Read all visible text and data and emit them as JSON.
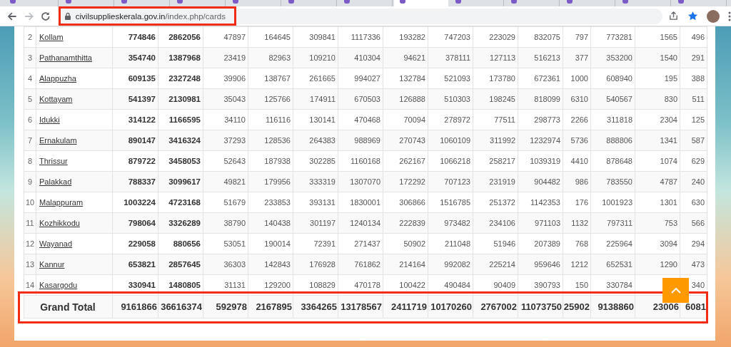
{
  "browser": {
    "tabs": [
      {
        "selected": false
      },
      {
        "selected": false
      },
      {
        "selected": false
      },
      {
        "selected": false
      },
      {
        "selected": false
      },
      {
        "selected": false
      },
      {
        "selected": false
      },
      {
        "selected": true
      },
      {
        "selected": false
      },
      {
        "selected": false
      },
      {
        "selected": false
      },
      {
        "selected": false
      },
      {
        "selected": false
      }
    ],
    "address_bar": {
      "host": "civilsupplieskerala.gov.in",
      "path": "/index.php/cards",
      "highlighted": true
    }
  },
  "table": {
    "rows": [
      {
        "no": "2",
        "district": "Kollam",
        "values": [
          "774846",
          "2862056",
          "47897",
          "164645",
          "309841",
          "1117336",
          "193282",
          "747203",
          "223029",
          "832075",
          "797",
          "773281",
          "1565",
          "496"
        ]
      },
      {
        "no": "3",
        "district": "Pathanamthitta",
        "values": [
          "354740",
          "1387968",
          "23419",
          "82963",
          "109210",
          "410304",
          "94621",
          "378111",
          "127113",
          "516213",
          "377",
          "353200",
          "1540",
          "291"
        ]
      },
      {
        "no": "4",
        "district": "Alappuzha",
        "values": [
          "609135",
          "2327248",
          "39906",
          "138767",
          "261665",
          "994027",
          "132784",
          "521093",
          "173780",
          "672361",
          "1000",
          "608940",
          "195",
          "388"
        ]
      },
      {
        "no": "5",
        "district": "Kottayam",
        "values": [
          "541397",
          "2130981",
          "35043",
          "125766",
          "174911",
          "670503",
          "126888",
          "510303",
          "198245",
          "818099",
          "6310",
          "540567",
          "830",
          "511"
        ]
      },
      {
        "no": "6",
        "district": "Idukki",
        "values": [
          "314122",
          "1166595",
          "34110",
          "116116",
          "130141",
          "470468",
          "70094",
          "278972",
          "77511",
          "298773",
          "2266",
          "311818",
          "2304",
          "125"
        ]
      },
      {
        "no": "7",
        "district": "Ernakulam",
        "values": [
          "890147",
          "3416324",
          "37293",
          "128536",
          "264383",
          "988969",
          "270743",
          "1060109",
          "311992",
          "1232974",
          "5736",
          "888806",
          "1341",
          "587"
        ]
      },
      {
        "no": "8",
        "district": "Thrissur",
        "values": [
          "879722",
          "3458053",
          "52643",
          "187938",
          "302285",
          "1160168",
          "262167",
          "1066218",
          "258217",
          "1039319",
          "4410",
          "878648",
          "1074",
          "629"
        ]
      },
      {
        "no": "9",
        "district": "Palakkad",
        "values": [
          "788337",
          "3099617",
          "49821",
          "179956",
          "333319",
          "1307070",
          "172292",
          "707123",
          "231919",
          "904482",
          "986",
          "783550",
          "4787",
          "240"
        ]
      },
      {
        "no": "10",
        "district": "Malappuram",
        "values": [
          "1003224",
          "4723168",
          "51679",
          "233853",
          "393131",
          "1830001",
          "306866",
          "1516785",
          "251372",
          "1142353",
          "176",
          "1001923",
          "1301",
          "630"
        ]
      },
      {
        "no": "11",
        "district": "Kozhikkodu",
        "values": [
          "798064",
          "3326289",
          "38790",
          "140438",
          "301197",
          "1240134",
          "222839",
          "973482",
          "234106",
          "971103",
          "1132",
          "797311",
          "753",
          "566"
        ]
      },
      {
        "no": "12",
        "district": "Wayanad",
        "values": [
          "229058",
          "880656",
          "53051",
          "190014",
          "72391",
          "271437",
          "50902",
          "211048",
          "51946",
          "207389",
          "768",
          "225964",
          "3094",
          "294"
        ]
      },
      {
        "no": "13",
        "district": "Kannur",
        "values": [
          "653821",
          "2857645",
          "36303",
          "142843",
          "176928",
          "761862",
          "214164",
          "992082",
          "225214",
          "959646",
          "1212",
          "652531",
          "1290",
          "473"
        ]
      },
      {
        "no": "14",
        "district": "Kasargodu",
        "values": [
          "330941",
          "1480805",
          "31131",
          "129200",
          "108829",
          "470178",
          "100422",
          "490484",
          "90409",
          "390793",
          "150",
          "330784",
          "340"
        ]
      }
    ],
    "total": {
      "label": "Grand Total",
      "values": [
        "9161866",
        "36616374",
        "592978",
        "2167895",
        "3364265",
        "13178567",
        "2411719",
        "10170260",
        "2767002",
        "11073750",
        "25902",
        "9138860",
        "23006",
        "6081"
      ],
      "highlighted": true
    }
  }
}
